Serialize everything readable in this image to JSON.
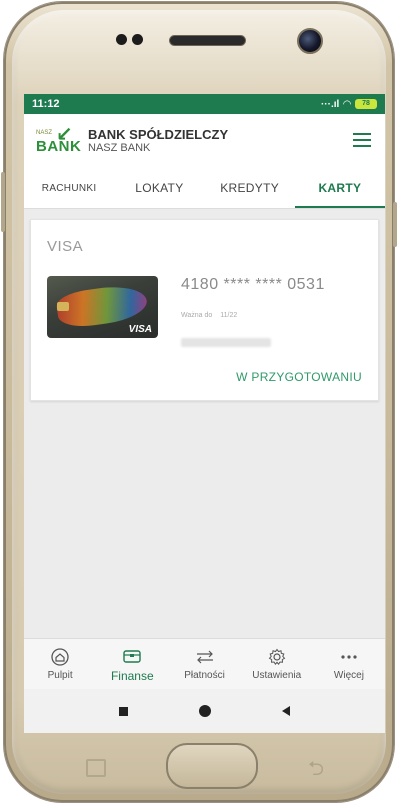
{
  "status": {
    "time": "11:12",
    "battery": "78"
  },
  "header": {
    "logo_small": "NASZ",
    "logo_word": "BANK",
    "bank_line1": "BANK SPÓŁDZIELCZY",
    "bank_line2": "NASZ BANK"
  },
  "tabs": [
    {
      "label": "RACHUNKI",
      "active": false
    },
    {
      "label": "LOKATY",
      "active": false
    },
    {
      "label": "KREDYTY",
      "active": false
    },
    {
      "label": "KARTY",
      "active": true
    }
  ],
  "card": {
    "type": "VISA",
    "number": "4180 **** **** 0531",
    "valid_label": "Ważna do",
    "valid_value": "11/22",
    "brand": "VISA",
    "status": "W PRZYGOTOWANIU"
  },
  "bottom_nav": [
    {
      "label": "Pulpit",
      "icon": "home-icon",
      "active": false
    },
    {
      "label": "Finanse",
      "icon": "wallet-icon",
      "active": true
    },
    {
      "label": "Płatności",
      "icon": "transfer-icon",
      "active": false
    },
    {
      "label": "Ustawienia",
      "icon": "gear-icon",
      "active": false
    },
    {
      "label": "Więcej",
      "icon": "more-icon",
      "active": false
    }
  ],
  "colors": {
    "brand_green": "#1e7a4f",
    "status_text": "#2f9a6a"
  }
}
